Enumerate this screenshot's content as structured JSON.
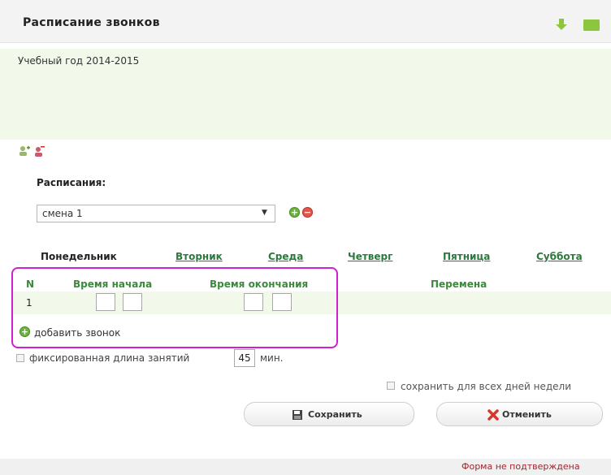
{
  "header": {
    "title": "Расписание звонков"
  },
  "year_label": "Учебный год 2014-2015",
  "schedules": {
    "label": "Расписания:",
    "selected": "смена 1"
  },
  "days": [
    "Понедельник",
    "Вторник",
    "Среда",
    "Четверг",
    "Пятница",
    "Суббота"
  ],
  "table": {
    "headers": {
      "n": "N",
      "start": "Время начала",
      "end": "Время окончания",
      "break": "Перемена"
    },
    "rows": [
      {
        "n": "1"
      }
    ]
  },
  "add_bell": "добавить звонок",
  "fixed_length": {
    "label": "фиксированная длина занятий",
    "value": "45",
    "unit": "мин."
  },
  "save_all_days": "сохранить для всех дней недели",
  "buttons": {
    "save": "Сохранить",
    "cancel": "Отменить"
  },
  "footer": {
    "status": "Форма не подтверждена"
  },
  "colors": {
    "accent_green": "#6cb33e",
    "highlight": "#d020d0",
    "status_red": "#a0252e"
  }
}
